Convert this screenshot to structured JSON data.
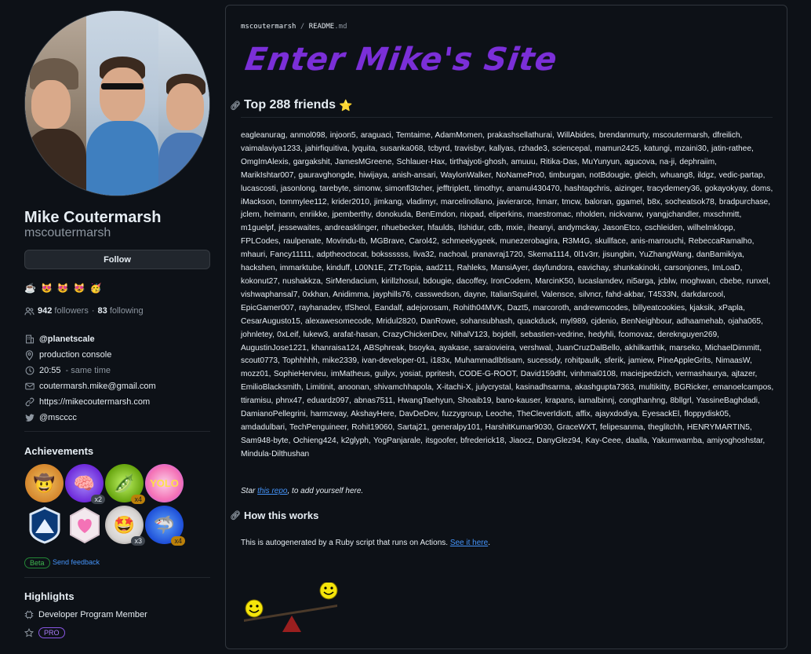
{
  "profile": {
    "name": "Mike Coutermarsh",
    "login": "mscoutermarsh",
    "follow_label": "Follow",
    "emojis": [
      "☕",
      "😻",
      "😻",
      "😻",
      "🥳"
    ],
    "followers_count": "942",
    "followers_label": "followers",
    "following_count": "83",
    "following_label": "following",
    "org": "@planetscale",
    "location": "production console",
    "time": "20:55",
    "time_suffix": "- same time",
    "email": "coutermarsh.mike@gmail.com",
    "website": "https://mikecoutermarsh.com",
    "twitter": "@mscccc"
  },
  "achievements": {
    "title": "Achievements",
    "badges": [
      {
        "icon": "cowboy-badge-icon",
        "glyph": "🤠",
        "count": ""
      },
      {
        "icon": "brain-badge-icon",
        "glyph": "🧠",
        "count": "x2"
      },
      {
        "icon": "peas-badge-icon",
        "glyph": "🫛",
        "count": "x4"
      },
      {
        "icon": "yolo-badge-icon",
        "glyph": "YOLO",
        "count": ""
      },
      {
        "icon": "arctic-badge-icon",
        "glyph": "⛰",
        "count": ""
      },
      {
        "icon": "heart-badge-icon",
        "glyph": "♥",
        "count": ""
      },
      {
        "icon": "starstruck-badge-icon",
        "glyph": "🤩",
        "count": "x3"
      },
      {
        "icon": "shark-badge-icon",
        "glyph": "🦈",
        "count": "x4"
      }
    ],
    "beta_label": "Beta",
    "feedback_label": "Send feedback"
  },
  "highlights": {
    "title": "Highlights",
    "member_label": "Developer Program Member",
    "pro_label": "PRO"
  },
  "readme": {
    "crumb_user": "mscoutermarsh",
    "crumb_sep": "/",
    "crumb_file": "README",
    "crumb_ext": ".md",
    "banner_text": "Enter Mike's Site",
    "friends_heading": "Top 288 friends",
    "friends_star": "⭐",
    "friends_list": "eagleanurag, anmol098, injoon5, araguaci, Temtaime, AdamMomen, prakashsellathurai, WillAbides, brendanmurty, mscoutermarsh, dfreilich, vaimalaviya1233, jahirfiquitiva, lyquita, susanka068, tcbyrd, travisbyr, kallyas, rzhade3, sciencepal, mamun2425, katungi, mzaini30, jatin-rathee, OmgImAlexis, gargakshit, JamesMGreene, Schlauer-Hax, tirthajyoti-ghosh, amuuu, Ritika-Das, MuYunyun, agucova, na-ji, dephraiim, MarikIshtar007, gauravghongde, hiwijaya, anish-ansari, WaylonWalker, NoNamePro0, timburgan, notBdougie, gleich, whuang8, ildgz, vedic-partap, lucascosti, jasonlong, tarebyte, simonw, simonfl3tcher, jefftriplett, timothyr, anamul430470, hashtagchris, aizinger, tracydemery36, gokayokyay, doms, iMackson, tommylee112, krider2010, jimkang, vladimyr, marcelinollano, javierarce, hmarr, tmcw, baloran, ggamel, b8x, socheatsok78, bradpurchase, jclem, heimann, enriikke, jpemberthy, donokuda, BenEmdon, nixpad, eliperkins, maestromac, nholden, nickvanw, ryangjchandler, mxschmitt, m1guelpf, jessewaites, andreasklinger, nhuebecker, hfaulds, Ilshidur, cdb, mxie, iheanyi, andymckay, JasonEtco, cschleiden, wilhelmklopp, FPLCodes, raulpenate, Movindu-tb, MGBrave, Carol42, schmeekygeek, munezerobagira, R3M4G, skullface, anis-marrouchi, RebeccaRamalho, mhauri, Fancy11111, adptheoctocat, bokssssss, liva32, nachoal, pranavraj1720, Skema1114, 0l1v3rr, jisungbin, YuZhangWang, danBamikiya, hackshen, immarktube, kinduff, L00N1E, ZTzTopia, aad211, Rahleks, MansiAyer, dayfundora, eavichay, shunkakinoki, carsonjones, ImLoaD, kokonut27, nushakkza, SirMendacium, kirillzhosul, bdougie, dacoffey, IronCodem, MarcinK50, lucaslamdev, ni5arga, jcblw, moghwan, cbebe, runxel, vishwaphansal7, 0xkhan, Anidimma, jayphills76, casswedson, dayne, ItalianSquirel, Valensce, silvncr, fahd-akbar, T4533N, darkdarcool, EpicGamer007, rayhanadev, tfSheol, Eandalf, adejorosam, Rohith04MVK, Dazt5, marcoroth, andrewmcodes, billyeatcookies, kjaksik, xPapla, CesarAugusto15, alexawesomecode, Mridul2820, DanRowe, sohansubhash, quackduck, myl989, cjdenio, BenNeighbour, adhaamehab, ojaha065, johnletey, 0xLeif, lukew3, arafat-hasan, CrazyChickenDev, NihalV123, bojdell, sebastien-vedrine, hedyhli, fcomovaz, dereknguyen269, AugustinJose1221, khanraisa124, ABSphreak, bsoyka, ayakase, saraiovieira, vershwal, JuanCruzDalBello, akhilkarthik, marseko, MichaelDimmitt, scout0773, Tophhhhh, mike2339, ivan-developer-01, i183x, MuhammadIbtisam, sucessdy, rohitpaulk, sferik, jamiew, PineAppleGrits, NimaasW, mozz01, SophieHervieu, imMatheus, guilyx, yosiat, ppritesh, CODE-G-ROOT, David159dht, vinhmai0108, maciejpedzich, vermashaurya, ajtazer, EmilioBlacksmith, Limitinit, anoonan, shivamchhapola, X-itachi-X, julycrystal, kasinadhsarma, akashgupta7363, multikitty, BGRicker, emanoelcampos, ttiramisu, phnx47, eduardz097, abnas7511, HwangTaehyun, Shoaib19, bano-kauser, krapans, iamalbinnj, congthanhng, 8bllgrl, YassineBaghdadi, DamianoPellegrini, harmzway, AkshayHere, DavDeDev, fuzzygroup, Leoche, TheCleverIdiott, affix, ajayxdodiya, EyesackEl, floppydisk05, amdadulbari, TechPenguineer, Rohit19060, Sartaj21, generalpy101, HarshitKumar9030, GraceWXT, felipesanma, theglitchh, HENRYMARTIN5, Sam948-byte, Ochieng424, k2glyph, YogPanjarale, itsgoofer, bfrederick18, Jiaocz, DanyGlez94, Kay-Ceee, daalla, Yakumwamba, amiyoghoshstar, Mindula-Dilthushan",
    "star_prefix": "Star ",
    "star_link": "this repo",
    "star_suffix": ", to add yourself here.",
    "how_heading": "How this works",
    "auto_text": "This is autogenerated by a Ruby script that runs on Actions. ",
    "auto_link": "See it here",
    "auto_end": "."
  }
}
